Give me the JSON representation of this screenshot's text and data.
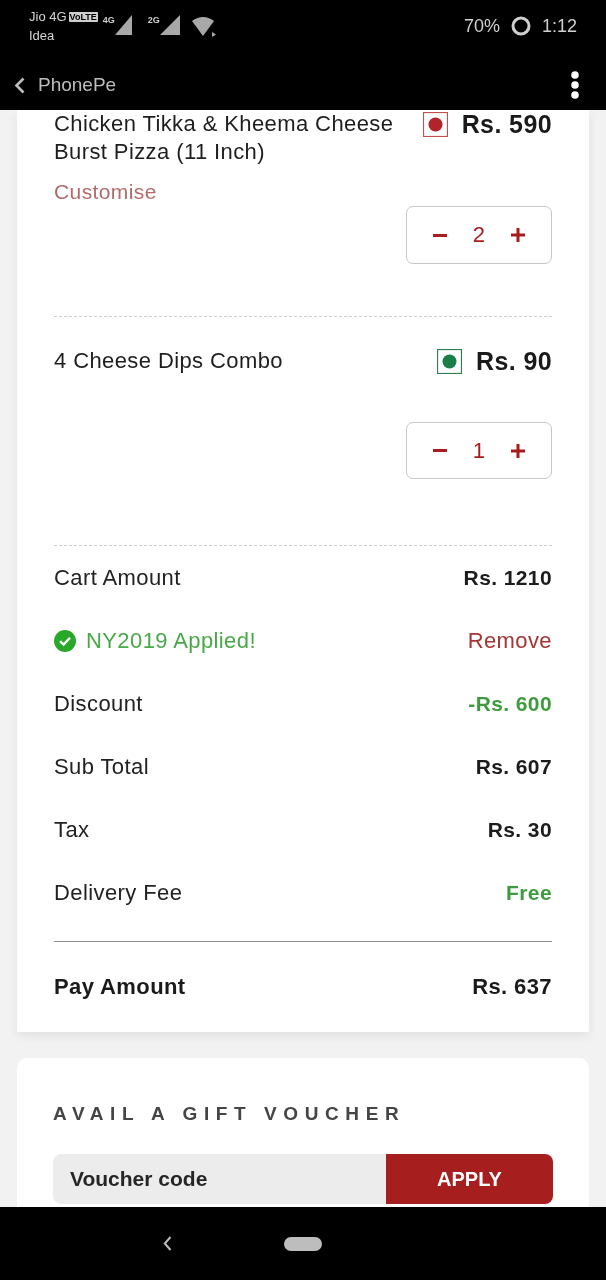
{
  "status_bar": {
    "carrier_1": "Jio 4G",
    "volte_badge": "VoLTE",
    "sim_1_network": "4G",
    "sim_2_network": "2G",
    "carrier_2": "Idea",
    "battery_percent": "70%",
    "time": "1:12"
  },
  "app_bar": {
    "back_label": "PhonePe"
  },
  "cart_items": [
    {
      "kind": "non_veg",
      "name": "Chicken Tikka & Kheema Cheese Burst Pizza (11 Inch)",
      "price": "Rs. 590",
      "customise": "Customise",
      "quantity": "2"
    },
    {
      "kind": "veg",
      "name": "4 Cheese Dips Combo",
      "price": "Rs. 90",
      "quantity": "1"
    }
  ],
  "summary": {
    "rows": [
      {
        "kind": "amount",
        "label": "Cart Amount",
        "value": "Rs. 1210",
        "color": "#1c1c1c"
      },
      {
        "kind": "coupon",
        "label": "NY2019 Applied!",
        "action": "Remove"
      },
      {
        "kind": "amount",
        "label": "Discount",
        "value": "-Rs. 600",
        "color": "#3f9b3f"
      },
      {
        "kind": "amount",
        "label": "Sub Total",
        "value": "Rs. 607",
        "color": "#1c1c1c"
      },
      {
        "kind": "amount",
        "label": "Tax",
        "value": "Rs. 30",
        "color": "#1c1c1c"
      },
      {
        "kind": "amount",
        "label": "Delivery Fee",
        "value": "Free",
        "color": "#3f9b3f"
      }
    ],
    "total": {
      "label": "Pay Amount",
      "value": "Rs. 637"
    }
  },
  "gift_voucher": {
    "title": "AVAIL A GIFT VOUCHER",
    "placeholder": "Voucher code",
    "button": "APPLY"
  }
}
